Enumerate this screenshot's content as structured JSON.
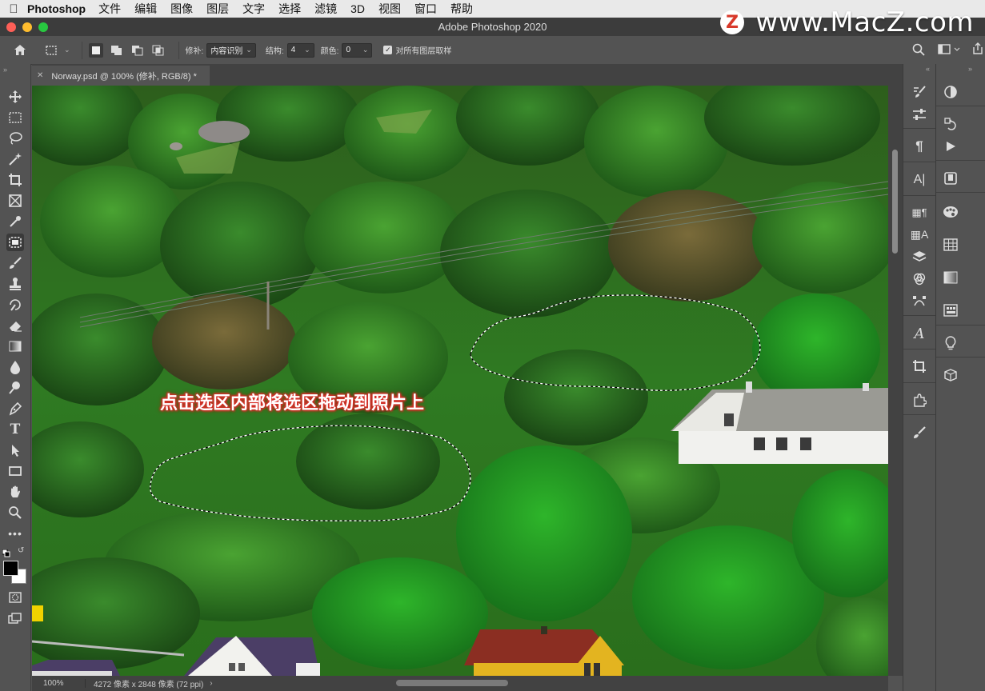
{
  "menubar": {
    "app_name": "Photoshop",
    "items": [
      "文件",
      "编辑",
      "图像",
      "图层",
      "文字",
      "选择",
      "滤镜",
      "3D",
      "视图",
      "窗口",
      "帮助"
    ]
  },
  "watermark": {
    "logo_letter": "Z",
    "text": "www.MacZ.com"
  },
  "window": {
    "title": "Adobe Photoshop 2020"
  },
  "options": {
    "patch_label": "修补:",
    "patch_value": "内容识别",
    "structure_label": "结构:",
    "structure_value": "4",
    "color_label": "颜色:",
    "color_value": "0",
    "sample_all_label": "对所有图层取样",
    "sample_all_checked": true
  },
  "document": {
    "tab_title": "Norway.psd @ 100% (修补, RGB/8) *",
    "caption": "点击选区内部将选区拖动到照片上"
  },
  "status": {
    "zoom": "100%",
    "doc_info": "4272 像素 x 2848 像素 (72 ppi)"
  },
  "colors": {
    "accent_annotation": "#d9302a",
    "foreground": "#000000",
    "background": "#ffffff"
  },
  "tools": [
    "move-tool",
    "marquee-tool",
    "lasso-tool",
    "magic-wand-tool",
    "crop-tool",
    "frame-tool",
    "eyedropper-tool",
    "patch-tool",
    "brush-tool",
    "stamp-tool",
    "history-brush-tool",
    "eraser-tool",
    "gradient-tool",
    "blur-tool",
    "dodge-tool",
    "pen-tool",
    "type-tool",
    "path-selection-tool",
    "rectangle-tool",
    "hand-tool",
    "zoom-tool",
    "more-tools"
  ]
}
